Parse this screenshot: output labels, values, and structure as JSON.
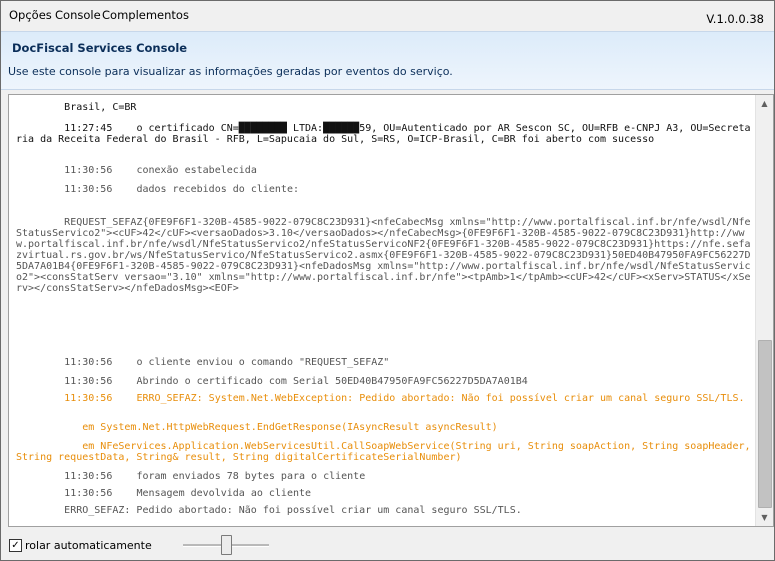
{
  "menu": {
    "items": [
      "Opções",
      "Console",
      "Complementos"
    ],
    "version": "V.1.0.0.38"
  },
  "header": {
    "title": "DocFiscal Services Console",
    "description": "Use este console para visualizar as informações geradas por eventos do serviço."
  },
  "console": {
    "lines": [
      {
        "time": "",
        "text": "Brasil, C=BR",
        "color": "black",
        "partial": true
      },
      {
        "time": "11:27:45",
        "text": "o certificado CN=████████ LTDA:██████59, OU=Autenticado por AR Sescon SC, OU=RFB e-CNPJ A3, OU=Secretaria da Receita Federal do Brasil - RFB, L=Sapucaia do Sul, S=RS, O=ICP-Brasil, C=BR foi aberto com sucesso",
        "color": "black"
      },
      {
        "time": "11:30:56",
        "text": "conexão estabelecida",
        "color": "gray"
      },
      {
        "time": "11:30:56",
        "text": "dados recebidos do cliente:",
        "color": "gray"
      },
      {
        "time": "",
        "text": "REQUEST_SEFAZ{0FE9F6F1-320B-4585-9022-079C8C23D931}<nfeCabecMsg xmlns=\"http://www.portalfiscal.inf.br/nfe/wsdl/NfeStatusServico2\"><cUF>42</cUF><versaoDados>3.10</versaoDados></nfeCabecMsg>{0FE9F6F1-320B-4585-9022-079C8C23D931}http://www.portalfiscal.inf.br/nfe/wsdl/NfeStatusServico2/nfeStatusServicoNF2{0FE9F6F1-320B-4585-9022-079C8C23D931}https://nfe.sefazvirtual.rs.gov.br/ws/NfeStatusServico/NfeStatusServico2.asmx{0FE9F6F1-320B-4585-9022-079C8C23D931}50ED40B47950FA9FC56227D5DA7A01B4{0FE9F6F1-320B-4585-9022-079C8C23D931}<nfeDadosMsg xmlns=\"http://www.portalfiscal.inf.br/nfe/wsdl/NfeStatusServico2\"><consStatServ versao=\"3.10\" xmlns=\"http://www.portalfiscal.inf.br/nfe\"><tpAmb>1</tpAmb><cUF>42</cUF><xServ>STATUS</xServ></consStatServ></nfeDadosMsg><EOF>",
        "color": "gray"
      },
      {
        "time": "11:30:56",
        "text": "o cliente enviou o comando \"REQUEST_SEFAZ\"",
        "color": "gray"
      },
      {
        "time": "11:30:56",
        "text": "Abrindo o certificado com Serial 50ED40B47950FA9FC56227D5DA7A01B4",
        "color": "gray"
      },
      {
        "time": "11:30:56",
        "text": "ERRO_SEFAZ: System.Net.WebException: Pedido abortado: Não foi possível criar um canal seguro SSL/TLS.",
        "color": "orange"
      },
      {
        "time": "",
        "text": "   em System.Net.HttpWebRequest.EndGetResponse(IAsyncResult asyncResult)",
        "color": "orange"
      },
      {
        "time": "",
        "text": "   em NFeServices.Application.WebServicesUtil.CallSoapWebService(String uri, String soapAction, String soapHeader, String requestData, String& result, String digitalCertificateSerialNumber)",
        "color": "orange"
      },
      {
        "time": "11:30:56",
        "text": "foram enviados 78 bytes para o cliente",
        "color": "gray"
      },
      {
        "time": "11:30:56",
        "text": "Mensagem devolvida ao cliente",
        "color": "gray"
      },
      {
        "time": "",
        "text": "ERRO_SEFAZ: Pedido abortado: Não foi possível criar um canal seguro SSL/TLS.",
        "color": "gray"
      }
    ]
  },
  "footer": {
    "autoscroll_label": "rolar automaticamente",
    "autoscroll_checked": true,
    "slider_value": 0.5
  },
  "colors": {
    "header_bg": "#dcebfa",
    "header_text": "#0b2e59",
    "log_black": "#111111",
    "log_gray": "#555555",
    "log_orange": "#e88e0b"
  }
}
